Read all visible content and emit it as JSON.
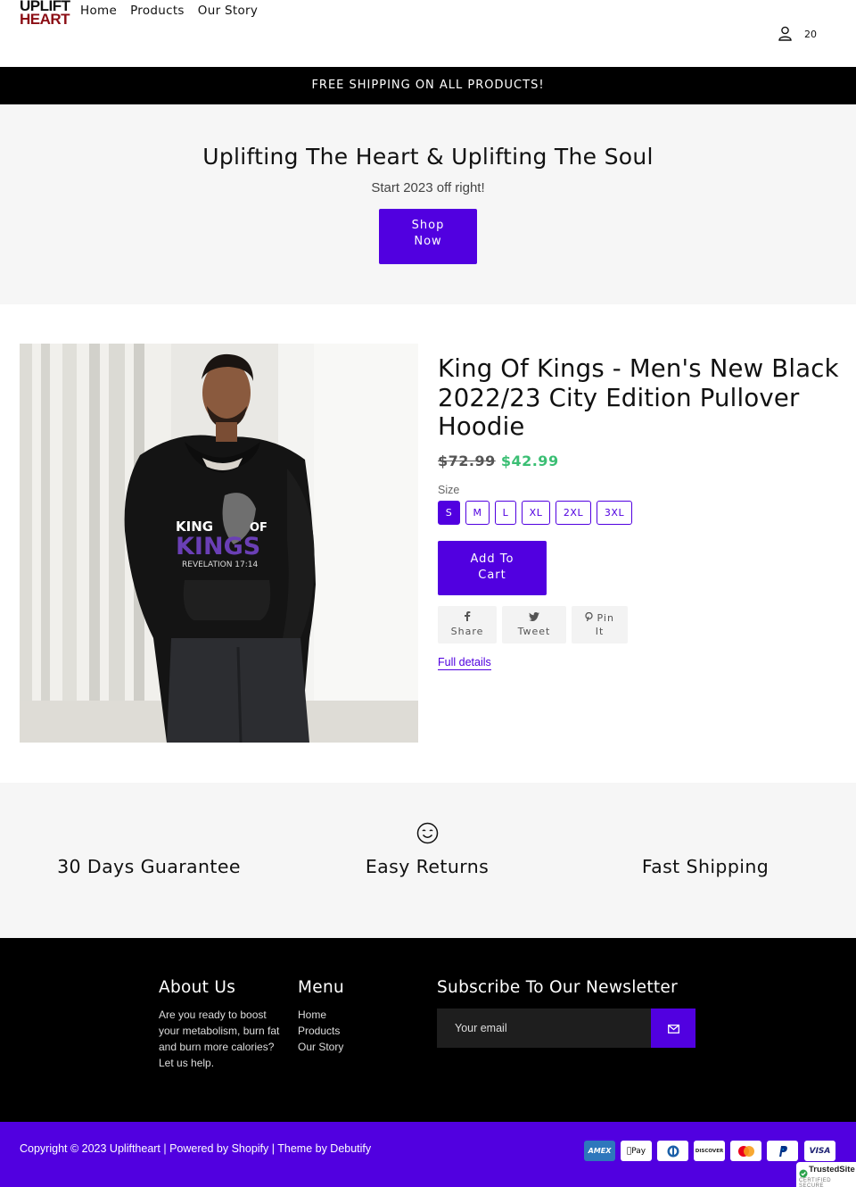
{
  "header": {
    "logo_top": "UPLIFT",
    "logo_bottom": "HEART",
    "nav": [
      "Home",
      "Products",
      "Our Story"
    ],
    "icons": [
      "user-icon",
      "cart-icon"
    ]
  },
  "announcement": "FREE SHIPPING ON ALL PRODUCTS!",
  "hero": {
    "title": "Uplifting The Heart & Uplifting The Soul",
    "subtitle": "Start 2023 off right!",
    "button_line1": "Shop",
    "button_line2": "Now"
  },
  "product": {
    "title": "King Of Kings - Men's New Black 2022/23 City Edition Pullover Hoodie",
    "price_old": "$72.99",
    "price_new": "$42.99",
    "size_label": "Size",
    "sizes": [
      "S",
      "M",
      "L",
      "XL",
      "2XL",
      "3XL"
    ],
    "selected_size": "S",
    "add_to_cart_line1": "Add To",
    "add_to_cart_line2": "Cart",
    "share": {
      "icon": "facebook-icon",
      "label": "Share"
    },
    "tweet": {
      "icon": "twitter-icon",
      "label": "Tweet"
    },
    "pin": {
      "icon": "pinterest-icon",
      "label_line1": "Pin",
      "label_line2": "It"
    },
    "full_details": "Full details",
    "print_line1": "KING",
    "print_line1b": "OF",
    "print_line2": "KINGS",
    "print_line3": "REVELATION 17:14"
  },
  "features": {
    "icon": "smile-icon",
    "items": [
      "30 Days Guarantee",
      "Easy Returns",
      "Fast Shipping"
    ]
  },
  "footer": {
    "about_title": "About Us",
    "about_text": "Are you ready to boost your metabolism, burn fat and burn more calories? Let us help.",
    "menu_title": "Menu",
    "menu_items": [
      "Home",
      "Products",
      "Our Story"
    ],
    "newsletter_title": "Subscribe To Our Newsletter",
    "email_placeholder": "Your email"
  },
  "bottom": {
    "copyright": "Copyright © 2023 Upliftheart | Powered by Shopify | Theme by Debutify",
    "payments": [
      "AMEX",
      "Pay",
      "Diners Club",
      "DISCOVER",
      "Mastercard",
      "PayPal",
      "VISA"
    ],
    "trusted_title": "TrustedSite",
    "trusted_sub": "CERTIFIED SECURE"
  },
  "colors": {
    "accent": "#5100e0",
    "sale_price": "#3bbf74",
    "hero_bg": "#f6f6f6",
    "footer_bg": "#000000",
    "logo_red": "#8b0d14"
  }
}
